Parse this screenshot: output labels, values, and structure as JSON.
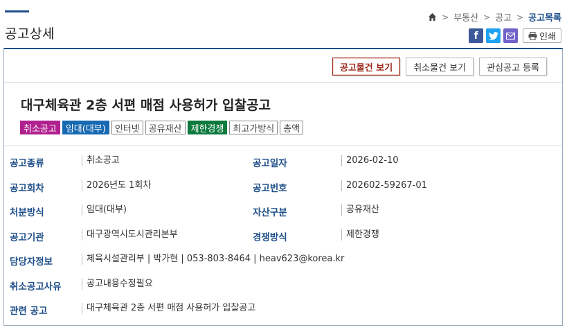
{
  "page": {
    "title": "공고상세"
  },
  "breadcrumb": {
    "items": [
      "부동산",
      "공고"
    ],
    "current": "공고목록",
    "separator": ">"
  },
  "share": {
    "facebook": "f",
    "print_label": "인쇄"
  },
  "actions": {
    "view_items": "공고물건 보기",
    "view_cancelled": "취소물건 보기",
    "register_interest": "관심공고 등록"
  },
  "notice": {
    "title": "대구체육관 2층 서편 매점 사용허가 입찰공고",
    "tags": [
      "취소공고",
      "임대(대부)",
      "인터넷",
      "공유재산",
      "제한경쟁",
      "최고가방식",
      "총액"
    ]
  },
  "details": {
    "type_label": "공고종류",
    "type_value": "취소공고",
    "date_label": "공고일자",
    "date_value": "2026-02-10",
    "round_label": "공고회차",
    "round_value": "2026년도 1회차",
    "number_label": "공고번호",
    "number_value": "202602-59267-01",
    "disposal_label": "처분방식",
    "disposal_value": "임대(대부)",
    "asset_label": "자산구분",
    "asset_value": "공유재산",
    "agency_label": "공고기관",
    "agency_value": "대구광역시도시관리본부",
    "competition_label": "경쟁방식",
    "competition_value": "제한경쟁",
    "contact_label": "담당자정보",
    "contact_value": "체육시설관리부 | 박가현 | 053-803-8464 | heav623@korea.kr",
    "cancel_reason_label": "취소공고사유",
    "cancel_reason_value": "공고내용수정필요",
    "related_label": "관련 공고",
    "related_value": "대구체육관 2층 서편 매점 사용허가 입찰공고"
  },
  "colors": {
    "accent": "#1d4e89",
    "cancel_tag": "#b0208f",
    "lease_tag": "#1769b2",
    "limited_tag": "#0c7a3d",
    "primary_button": "#9c2b1e"
  },
  "icons": {
    "home": "home-icon",
    "facebook": "facebook-icon",
    "twitter": "twitter-icon",
    "email": "email-icon",
    "print": "printer-icon"
  }
}
